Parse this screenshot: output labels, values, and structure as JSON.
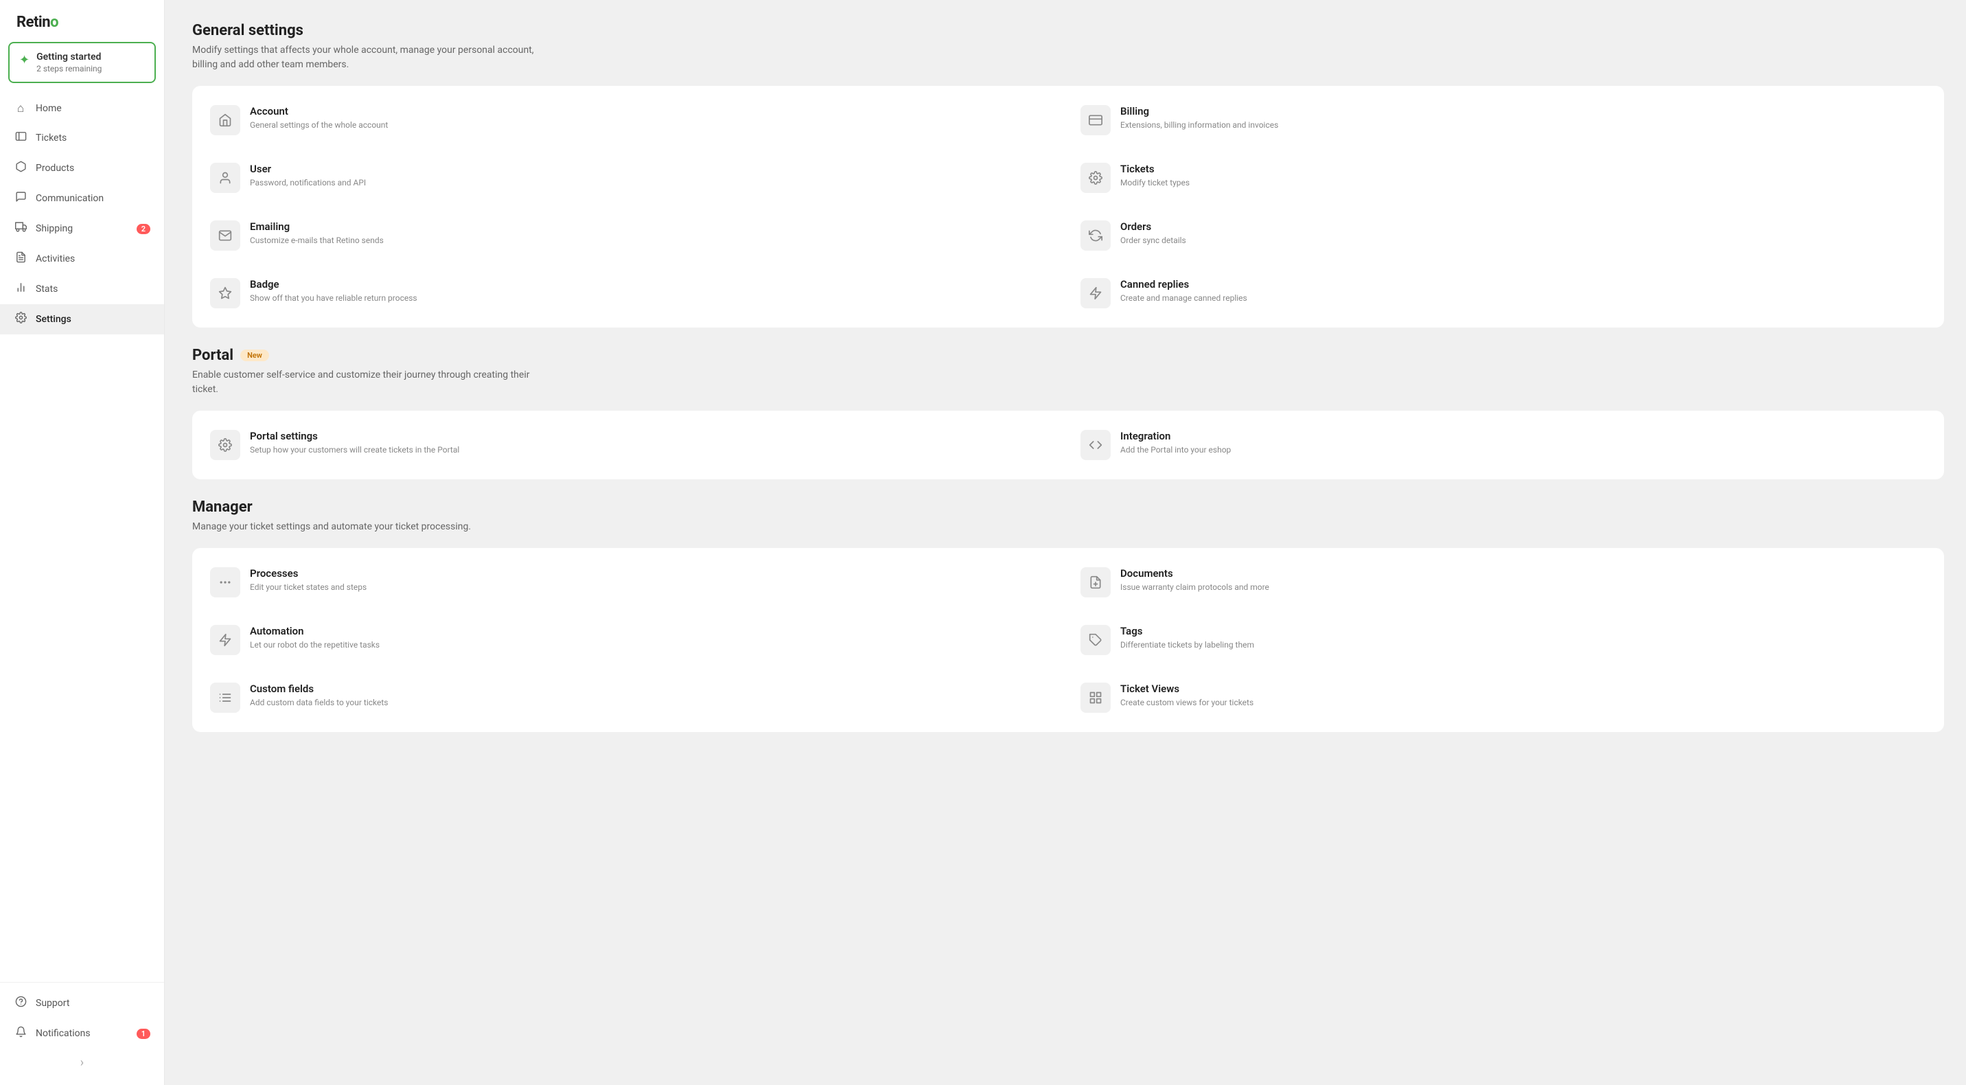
{
  "app": {
    "logo_text": "Retino",
    "logo_dot_color": "#4caf50"
  },
  "getting_started": {
    "title": "Getting started",
    "subtitle": "2 steps remaining"
  },
  "nav": {
    "items": [
      {
        "id": "home",
        "label": "Home",
        "icon": "🏠",
        "badge": null
      },
      {
        "id": "tickets",
        "label": "Tickets",
        "icon": "🎫",
        "badge": null
      },
      {
        "id": "products",
        "label": "Products",
        "icon": "📦",
        "badge": null
      },
      {
        "id": "communication",
        "label": "Communication",
        "icon": "💬",
        "badge": null
      },
      {
        "id": "shipping",
        "label": "Shipping",
        "icon": "🚚",
        "badge": "2"
      },
      {
        "id": "activities",
        "label": "Activities",
        "icon": "📋",
        "badge": null
      },
      {
        "id": "stats",
        "label": "Stats",
        "icon": "📊",
        "badge": null
      },
      {
        "id": "settings",
        "label": "Settings",
        "icon": "⚙️",
        "badge": null,
        "active": true
      }
    ],
    "bottom_items": [
      {
        "id": "support",
        "label": "Support",
        "icon": "❓",
        "badge": null
      },
      {
        "id": "notifications",
        "label": "Notifications",
        "icon": "🔔",
        "badge": "1"
      }
    ]
  },
  "page_title": "General settings",
  "page_desc": "Modify settings that affects your whole account, manage your personal account, billing and add other team members.",
  "sections": [
    {
      "id": "general",
      "title": "General settings",
      "desc": "Modify settings that affects your whole account, manage your personal account, billing and add other team members.",
      "badge": null,
      "items": [
        {
          "id": "account",
          "title": "Account",
          "desc": "General settings of the whole account",
          "icon": "🏠"
        },
        {
          "id": "billing",
          "title": "Billing",
          "desc": "Extensions, billing information and invoices",
          "icon": "💳"
        },
        {
          "id": "user",
          "title": "User",
          "desc": "Password, notifications and API",
          "icon": "👤"
        },
        {
          "id": "tickets",
          "title": "Tickets",
          "desc": "Modify ticket types",
          "icon": "⚙️"
        },
        {
          "id": "emailing",
          "title": "Emailing",
          "desc": "Customize e-mails that Retino sends",
          "icon": "✉️"
        },
        {
          "id": "orders",
          "title": "Orders",
          "desc": "Order sync details",
          "icon": "🔄"
        },
        {
          "id": "badge",
          "title": "Badge",
          "desc": "Show off that you have reliable return process",
          "icon": "⭐"
        },
        {
          "id": "canned_replies",
          "title": "Canned replies",
          "desc": "Create and manage canned replies",
          "icon": "⚡"
        }
      ]
    },
    {
      "id": "portal",
      "title": "Portal",
      "desc": "Enable customer self-service and customize their journey through creating their ticket.",
      "badge": "New",
      "items": [
        {
          "id": "portal_settings",
          "title": "Portal settings",
          "desc": "Setup how your customers will create tickets in the Portal",
          "icon": "⚙️"
        },
        {
          "id": "integration",
          "title": "Integration",
          "desc": "Add the Portal into your eshop",
          "icon": "</>"
        }
      ]
    },
    {
      "id": "manager",
      "title": "Manager",
      "desc": "Manage your ticket settings and automate your ticket processing.",
      "badge": null,
      "items": [
        {
          "id": "processes",
          "title": "Processes",
          "desc": "Edit your ticket states and steps",
          "icon": "···"
        },
        {
          "id": "documents",
          "title": "Documents",
          "desc": "Issue warranty claim protocols and more",
          "icon": "📄"
        },
        {
          "id": "automation",
          "title": "Automation",
          "desc": "Let our robot do the repetitive tasks",
          "icon": "⚡"
        },
        {
          "id": "tags",
          "title": "Tags",
          "desc": "Differentiate tickets by labeling them",
          "icon": "🏷️"
        },
        {
          "id": "custom_fields",
          "title": "Custom fields",
          "desc": "Add custom data fields to your tickets",
          "icon": "📝"
        },
        {
          "id": "ticket_views",
          "title": "Ticket Views",
          "desc": "Create custom views for your tickets",
          "icon": "👁️"
        }
      ]
    }
  ],
  "icons": {
    "home": "⌂",
    "tickets": "🎫",
    "products": "📦",
    "communication": "💬",
    "shipping": "🚚",
    "activities": "📋",
    "stats": "📊",
    "settings": "⚙️",
    "support": "❓",
    "notifications": "🔔",
    "account_setting": "⌂",
    "billing_setting": "💳",
    "user_setting": "👤",
    "tickets_setting": "⚙️",
    "emailing_setting": "✉️",
    "orders_setting": "🔄",
    "badge_setting": "☆",
    "canned_setting": "⚡",
    "portal_settings": "⚙️",
    "integration_setting": "</>",
    "processes_setting": "•••",
    "documents_setting": "📄",
    "automation_setting": "⚡",
    "tags_setting": "🏷",
    "custom_fields_setting": "≡",
    "ticket_views_setting": "👁"
  }
}
